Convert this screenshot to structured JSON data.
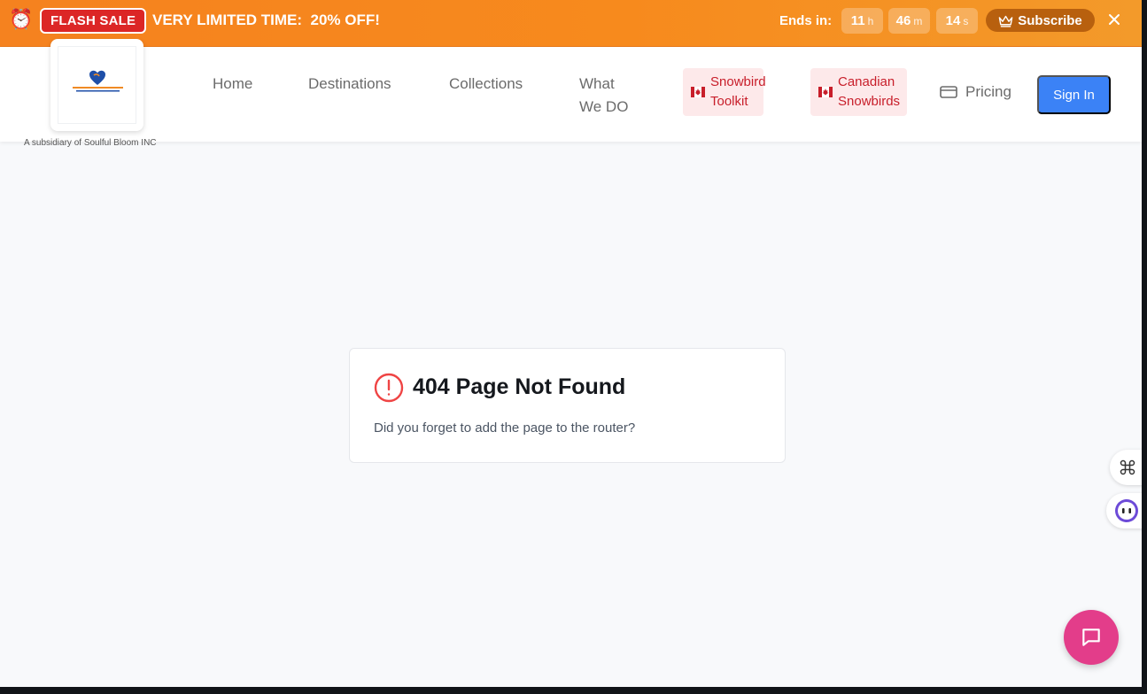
{
  "banner": {
    "alarm_icon": "alarm-clock-icon",
    "badge": "FLASH SALE",
    "text": "VERY LIMITED TIME:  20% OFF!",
    "ends_label": "Ends in:",
    "hours": "11",
    "hours_unit": "h",
    "minutes": "46",
    "minutes_unit": "m",
    "seconds": "14",
    "seconds_unit": "s",
    "subscribe_label": "Subscribe",
    "subscribe_icon": "crown-icon",
    "close_icon": "close-icon",
    "colors": {
      "banner": "#f5821f",
      "badge": "#dc2626",
      "subscribe": "#b8600e"
    }
  },
  "header": {
    "logo_tagline": "A subsidiary of Soulful Bloom INC",
    "nav": {
      "home": "Home",
      "destinations": "Destinations",
      "collections": "Collections",
      "what_line1": "What",
      "what_line2": "We DO",
      "toolkit_line1": "Snowbird",
      "toolkit_line2": "Toolkit",
      "canadian_line1": "Canadian",
      "canadian_line2": "Snowbirds",
      "pricing": "Pricing"
    },
    "pricing_icon": "credit-card-icon",
    "signin_label": "Sign In",
    "colors": {
      "signin": "#3b82f6",
      "pill_bg": "#fde9ea",
      "pill_text": "#c81e2a"
    }
  },
  "error": {
    "icon": "alert-circle-icon",
    "title": "404 Page Not Found",
    "message": "Did you forget to add the page to the router?",
    "icon_color": "#ef4444"
  },
  "widgets": {
    "command_icon": "command-icon",
    "assistant_icon": "assistant-face-icon",
    "chat_icon": "chat-bubble-icon",
    "chat_color": "#e33d8a"
  }
}
